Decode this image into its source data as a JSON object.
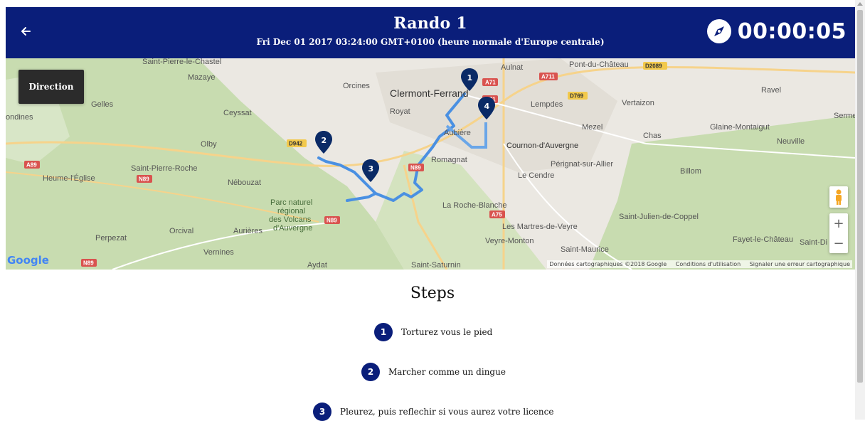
{
  "header": {
    "title": "Rando 1",
    "date": "Fri Dec 01 2017 03:24:00 GMT+0100 (heure normale d'Europe centrale)",
    "timer": "00:00:05",
    "back_icon": "arrow-left-icon",
    "compass_icon": "compass-icon"
  },
  "map": {
    "direction_label": "Direction",
    "footer": {
      "data": "Données cartographiques ©2018 Google",
      "terms": "Conditions d'utilisation",
      "report": "Signaler une erreur cartographique"
    },
    "google_logo": "Google",
    "zoom_in": "+",
    "zoom_out": "−",
    "places": [
      {
        "name": "Saint-Pierre-le-Chastel"
      },
      {
        "name": "Mazaye"
      },
      {
        "name": "Orcines"
      },
      {
        "name": "Clermont-Ferrand"
      },
      {
        "name": "Aulnat"
      },
      {
        "name": "Pont-du-Château"
      },
      {
        "name": "Gelles"
      },
      {
        "name": "Ceyssat"
      },
      {
        "name": "Royat"
      },
      {
        "name": "Lempdes"
      },
      {
        "name": "Vertaizon"
      },
      {
        "name": "Ravel"
      },
      {
        "name": "Serme"
      },
      {
        "name": "ondines"
      },
      {
        "name": "Olby"
      },
      {
        "name": "Aubière"
      },
      {
        "name": "Mezel"
      },
      {
        "name": "Chas"
      },
      {
        "name": "Glaine-Montaigut"
      },
      {
        "name": "Neuville"
      },
      {
        "name": "Cournon-d'Auvergne"
      },
      {
        "name": "Romagnat"
      },
      {
        "name": "Saint-Pierre-Roche"
      },
      {
        "name": "Heume-l'Église"
      },
      {
        "name": "Nébouzat"
      },
      {
        "name": "Pérignat-sur-Allier"
      },
      {
        "name": "Le Cendre"
      },
      {
        "name": "Billom"
      },
      {
        "name": "Parc naturel"
      },
      {
        "name": "régional"
      },
      {
        "name": "des Volcans"
      },
      {
        "name": "d'Auvergne"
      },
      {
        "name": "La Roche-Blanche"
      },
      {
        "name": "Perpezat"
      },
      {
        "name": "Orcival"
      },
      {
        "name": "Aurières"
      },
      {
        "name": "Les Martres-de-Veyre"
      },
      {
        "name": "Saint-Julien-de-Coppel"
      },
      {
        "name": "Veyre-Monton"
      },
      {
        "name": "Fayet-le-Château"
      },
      {
        "name": "Saint-Di"
      },
      {
        "name": "Vernines"
      },
      {
        "name": "Saint-Maurice"
      },
      {
        "name": "Aydat"
      },
      {
        "name": "Saint-Saturnin"
      }
    ],
    "roads": [
      "A71",
      "A711",
      "D2089",
      "D769",
      "D942",
      "A89",
      "N89",
      "N89",
      "A75",
      "N89",
      "N89",
      "A71"
    ],
    "markers": [
      "1",
      "2",
      "3",
      "4"
    ]
  },
  "steps": {
    "title": "Steps",
    "items": [
      {
        "number": "1",
        "label": "Torturez vous le pied"
      },
      {
        "number": "2",
        "label": "Marcher comme un dingue"
      },
      {
        "number": "3",
        "label": "Pleurez, puis reflechir si vous aurez votre licence"
      }
    ]
  },
  "colors": {
    "primary": "#0a1e7a",
    "route": "#4a90e2",
    "map_bg": "#ebe8e2",
    "park": "#c8dcb0"
  }
}
